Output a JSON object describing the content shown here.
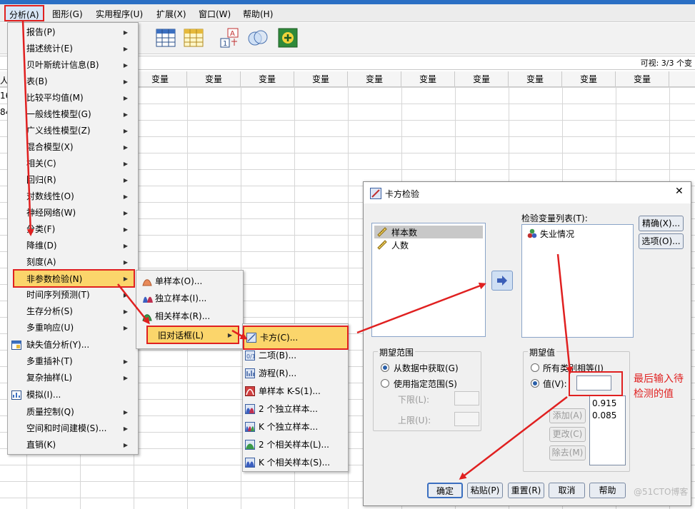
{
  "menubar": {
    "items": [
      "分析(A)",
      "图形(G)",
      "实用程序(U)",
      "扩展(X)",
      "窗口(W)",
      "帮助(H)"
    ]
  },
  "datagrid": {
    "visible_label": "可视: 3/3 个变",
    "column_header": "变量",
    "left_fragments": [
      "人",
      "16",
      "84"
    ]
  },
  "analysis_menu": {
    "items": [
      "报告(P)",
      "描述统计(E)",
      "贝叶斯统计信息(B)",
      "表(B)",
      "比较平均值(M)",
      "一般线性模型(G)",
      "广义线性模型(Z)",
      "混合模型(X)",
      "相关(C)",
      "回归(R)",
      "对数线性(O)",
      "神经网络(W)",
      "分类(F)",
      "降维(D)",
      "刻度(A)",
      "非参数检验(N)",
      "时间序列预测(T)",
      "生存分析(S)",
      "多重响应(U)",
      "缺失值分析(Y)...",
      "多重插补(T)",
      "复杂抽样(L)",
      "模拟(I)...",
      "质量控制(Q)",
      "空间和时间建模(S)...",
      "直销(K)"
    ]
  },
  "nonparam_menu": {
    "items": [
      "单样本(O)...",
      "独立样本(I)...",
      "相关样本(R)...",
      "旧对话框(L)"
    ]
  },
  "legacy_menu": {
    "items": [
      "卡方(C)...",
      "二项(B)...",
      "游程(R)...",
      "单样本 K-S(1)...",
      "2 个独立样本...",
      "K 个独立样本...",
      "2 个相关样本(L)...",
      "K 个相关样本(S)..."
    ]
  },
  "dialog": {
    "title": "卡方检验",
    "source_vars": [
      "样本数",
      "人数"
    ],
    "test_list_label": "检验变量列表(T):",
    "test_vars": [
      "失业情况"
    ],
    "btn_exact": "精确(X)...",
    "btn_options": "选项(O)...",
    "expected_range": {
      "title": "期望范围",
      "opt_data": "从数据中获取(G)",
      "opt_specified": "使用指定范围(S)",
      "lower": "下限(L):",
      "upper": "上限(U):"
    },
    "expected_values": {
      "title": "期望值",
      "opt_all_equal": "所有类别相等(I)",
      "opt_values": "值(V):",
      "value_input": "",
      "values_list": [
        "0.915",
        "0.085"
      ],
      "btn_add": "添加(A)",
      "btn_change": "更改(C)",
      "btn_remove": "除去(M)"
    },
    "buttons": {
      "ok": "确定",
      "paste": "粘贴(P)",
      "reset": "重置(R)",
      "cancel": "取消",
      "help": "帮助"
    }
  },
  "annotation": {
    "line1": "最后输入待",
    "line2": "检测的值"
  },
  "watermark": "@51CTO博客",
  "colors": {
    "highlight": "#fbd56b",
    "annotation_red": "#e02020",
    "selection": "#c8c8c8"
  }
}
